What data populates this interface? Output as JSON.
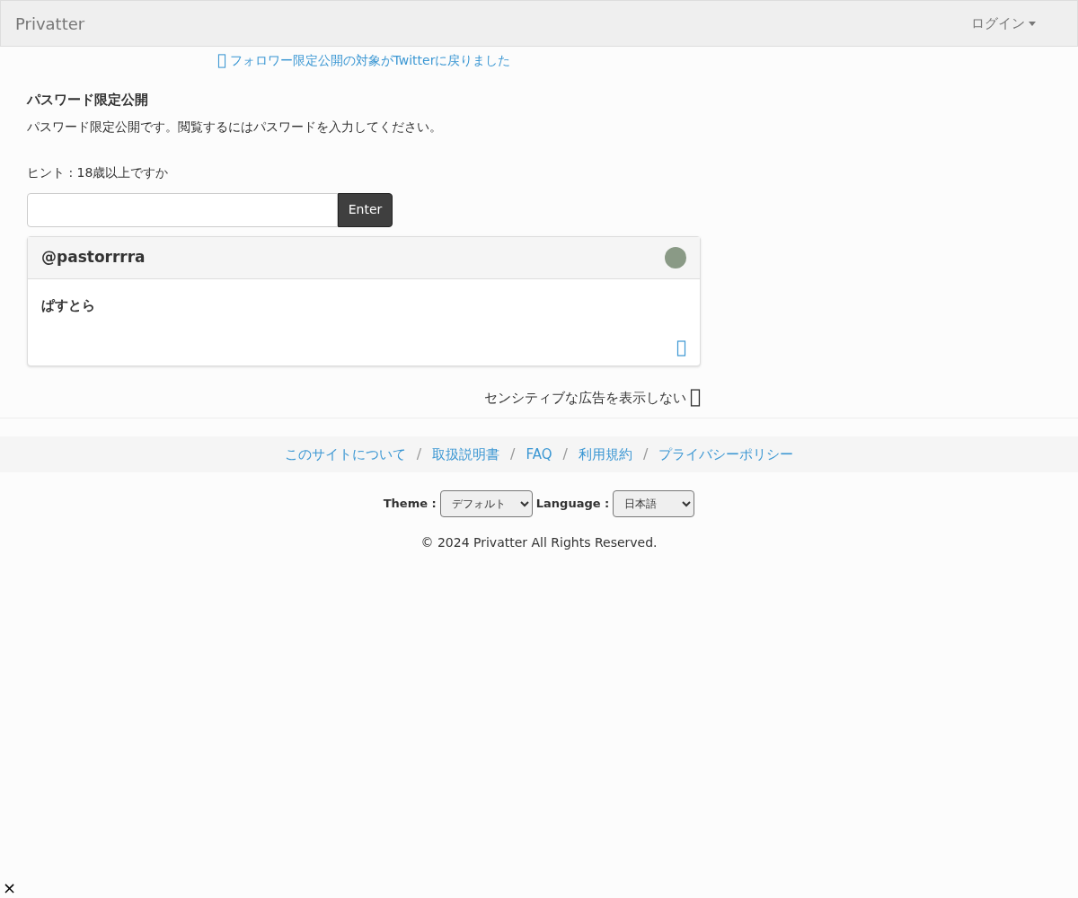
{
  "navbar": {
    "brand": "Privatter",
    "login": "ログイン"
  },
  "notice": "フォロワー限定公開の対象がTwitterに戻りました",
  "section": {
    "title": "パスワード限定公開",
    "description": "パスワード限定公開です。閲覧するにはパスワードを入力してください。",
    "hint": "ヒント : 18歳以上ですか",
    "button": "Enter"
  },
  "card": {
    "user": "@pastorrrra",
    "name": "ぱすとら"
  },
  "ads_toggle": "センシティブな広告を表示しない",
  "footer_links": [
    {
      "label": "このサイトについて"
    },
    {
      "separator": "/",
      "label": "取扱説明書"
    },
    {
      "separator": "/",
      "label": "FAQ"
    },
    {
      "separator": "/",
      "label": "利用規約"
    },
    {
      "separator": "/",
      "label": "プライバシーポリシー"
    }
  ],
  "theme": {
    "label": "Theme :",
    "value": "デフォルト"
  },
  "language": {
    "label": "Language :",
    "value": "日本語"
  },
  "copyright": "© 2024 Privatter All Rights Reserved.",
  "close": "×"
}
